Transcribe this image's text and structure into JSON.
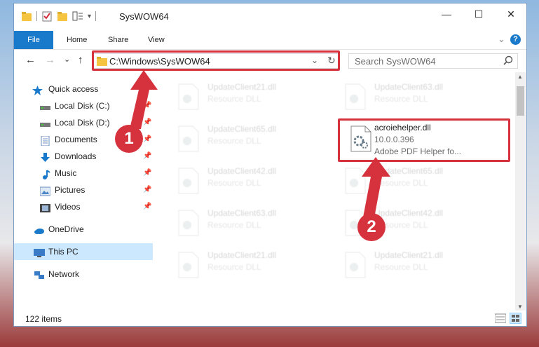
{
  "window": {
    "title": "SysWOW64",
    "controls": {
      "minimize": "—",
      "maximize": "☐",
      "close": "✕"
    }
  },
  "ribbon": {
    "tabs": [
      "File",
      "Home",
      "Share",
      "View"
    ],
    "collapse": "⌄",
    "help": "?"
  },
  "navigation": {
    "back": "←",
    "forward": "→",
    "recent": "⌄",
    "up": "↑",
    "address": "C:\\Windows\\SysWOW64",
    "address_dropdown": "⌄",
    "refresh": "↻",
    "search_placeholder": "Search SysWOW64"
  },
  "sidebar": {
    "items": [
      {
        "label": "Quick access",
        "icon": "star-icon"
      },
      {
        "label": "Local Disk (C:)",
        "icon": "drive-icon",
        "pinned": true
      },
      {
        "label": "Local Disk (D:)",
        "icon": "drive-icon",
        "pinned": true
      },
      {
        "label": "Documents",
        "icon": "documents-icon",
        "pinned": true
      },
      {
        "label": "Downloads",
        "icon": "downloads-icon",
        "pinned": true
      },
      {
        "label": "Music",
        "icon": "music-icon",
        "pinned": true
      },
      {
        "label": "Pictures",
        "icon": "pictures-icon",
        "pinned": true
      },
      {
        "label": "Videos",
        "icon": "videos-icon",
        "pinned": true
      },
      {
        "label": "OneDrive",
        "icon": "onedrive-icon"
      },
      {
        "label": "This PC",
        "icon": "pc-icon",
        "selected": true
      },
      {
        "label": "Network",
        "icon": "network-icon"
      }
    ]
  },
  "files": [
    {
      "name": "UpdateClient21.dll",
      "desc": "Resource DLL"
    },
    {
      "name": "UpdateClient63.dll",
      "desc": "Resource DLL"
    },
    {
      "name": "UpdateClient65.dll",
      "desc": "Resource DLL"
    },
    {
      "name": "acroiehelper.dll",
      "version": "10.0.0.396",
      "desc": "Adobe PDF Helper fo...",
      "highlighted": true
    },
    {
      "name": "UpdateClient42.dll",
      "desc": "Resource DLL"
    },
    {
      "name": "UpdateClient65.dll",
      "desc": "Resource DLL"
    },
    {
      "name": "UpdateClient63.dll",
      "desc": "Resource DLL"
    },
    {
      "name": "UpdateClient42.dll",
      "desc": "Resource DLL"
    },
    {
      "name": "UpdateClient21.dll",
      "desc": "Resource DLL"
    },
    {
      "name": "UpdateClient21.dll",
      "desc": "Resource DLL"
    }
  ],
  "status": {
    "count": "122 items"
  },
  "annotations": {
    "step1": "1",
    "step2": "2"
  },
  "colors": {
    "accent": "#1979ca",
    "highlight": "#d6323e",
    "selected": "#cce8ff"
  }
}
